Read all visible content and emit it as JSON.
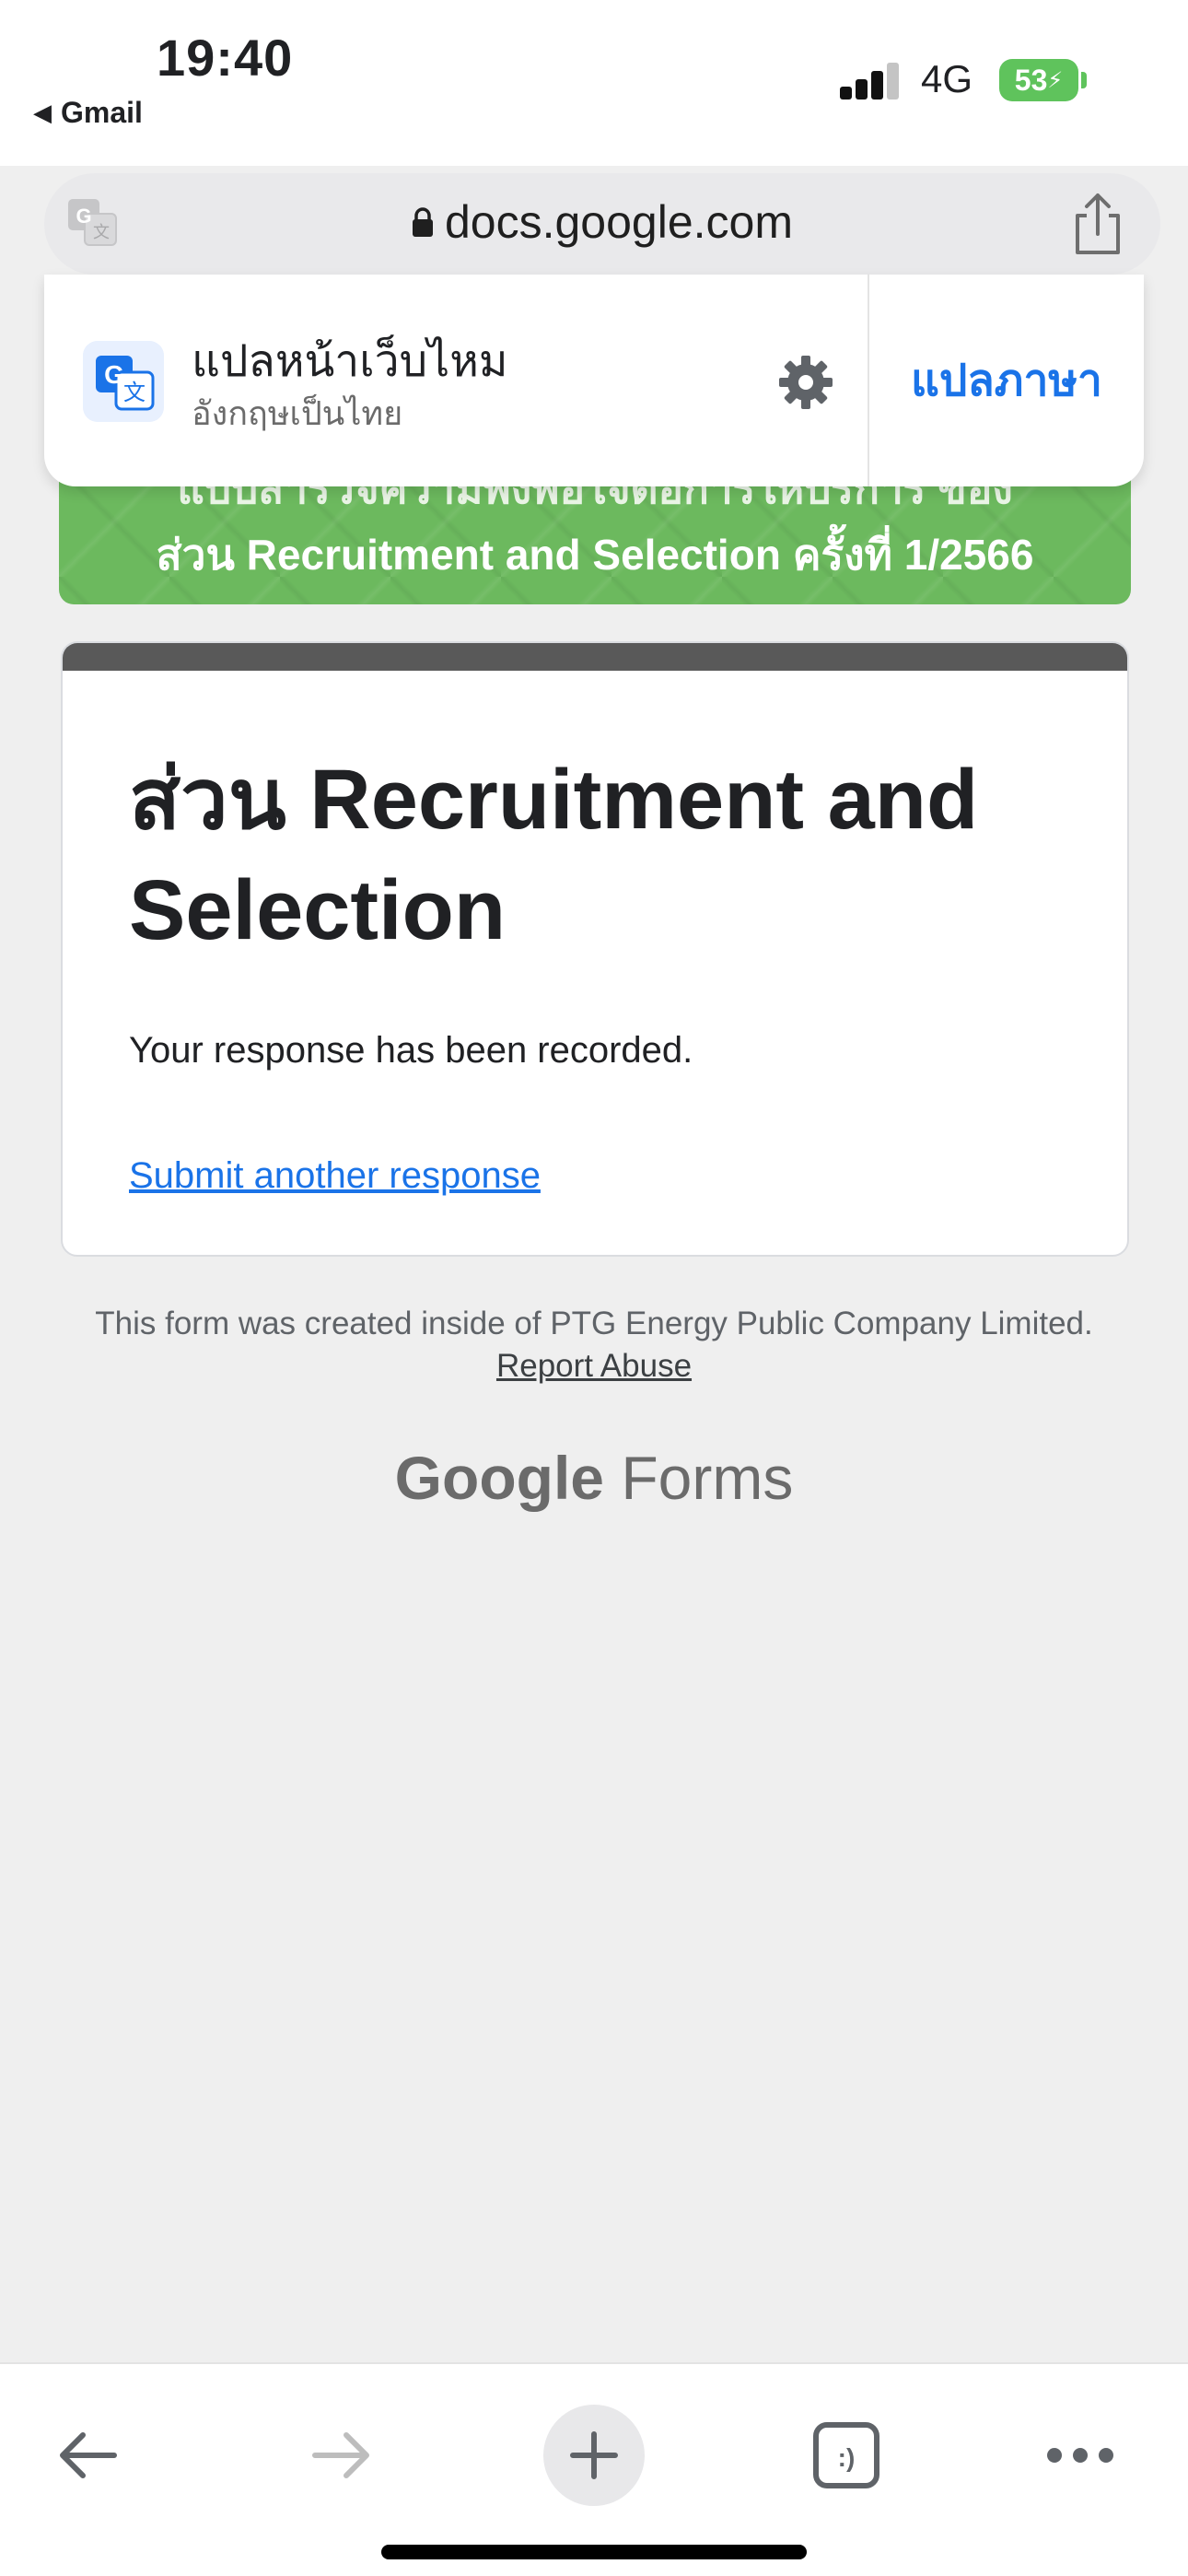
{
  "status_bar": {
    "time": "19:40",
    "back_app": "Gmail",
    "network": "4G",
    "battery": "53",
    "battery_color": "#5fc35c"
  },
  "address_bar": {
    "url": "docs.google.com"
  },
  "translate_popup": {
    "title": "แปลหน้าเว็บไหม",
    "subtitle": "อังกฤษเป็นไทย",
    "action_label": "แปลภาษา",
    "accent_color": "#1a73e8"
  },
  "banner": {
    "line1": "แบบสำรวจความพึงพอใจต่อการให้บริการ ของ",
    "line2": "ส่วน Recruitment and Selection ครั้งที่ 1/2566",
    "color": "#6cb95e"
  },
  "form": {
    "title": "ส่วน Recruitment and Selection",
    "confirmation": "Your response has been recorded.",
    "another_link": "Submit another response"
  },
  "footer": {
    "note": "This form was created inside of PTG Energy Public Company Limited.",
    "report_link": "Report Abuse",
    "logo_google": "Google",
    "logo_forms": "Forms"
  },
  "toolbar": {
    "tabs_icon_text": ":)",
    "icons": [
      "back-arrow-icon",
      "forward-arrow-icon",
      "plus-icon",
      "tabs-icon",
      "more-icon"
    ]
  }
}
